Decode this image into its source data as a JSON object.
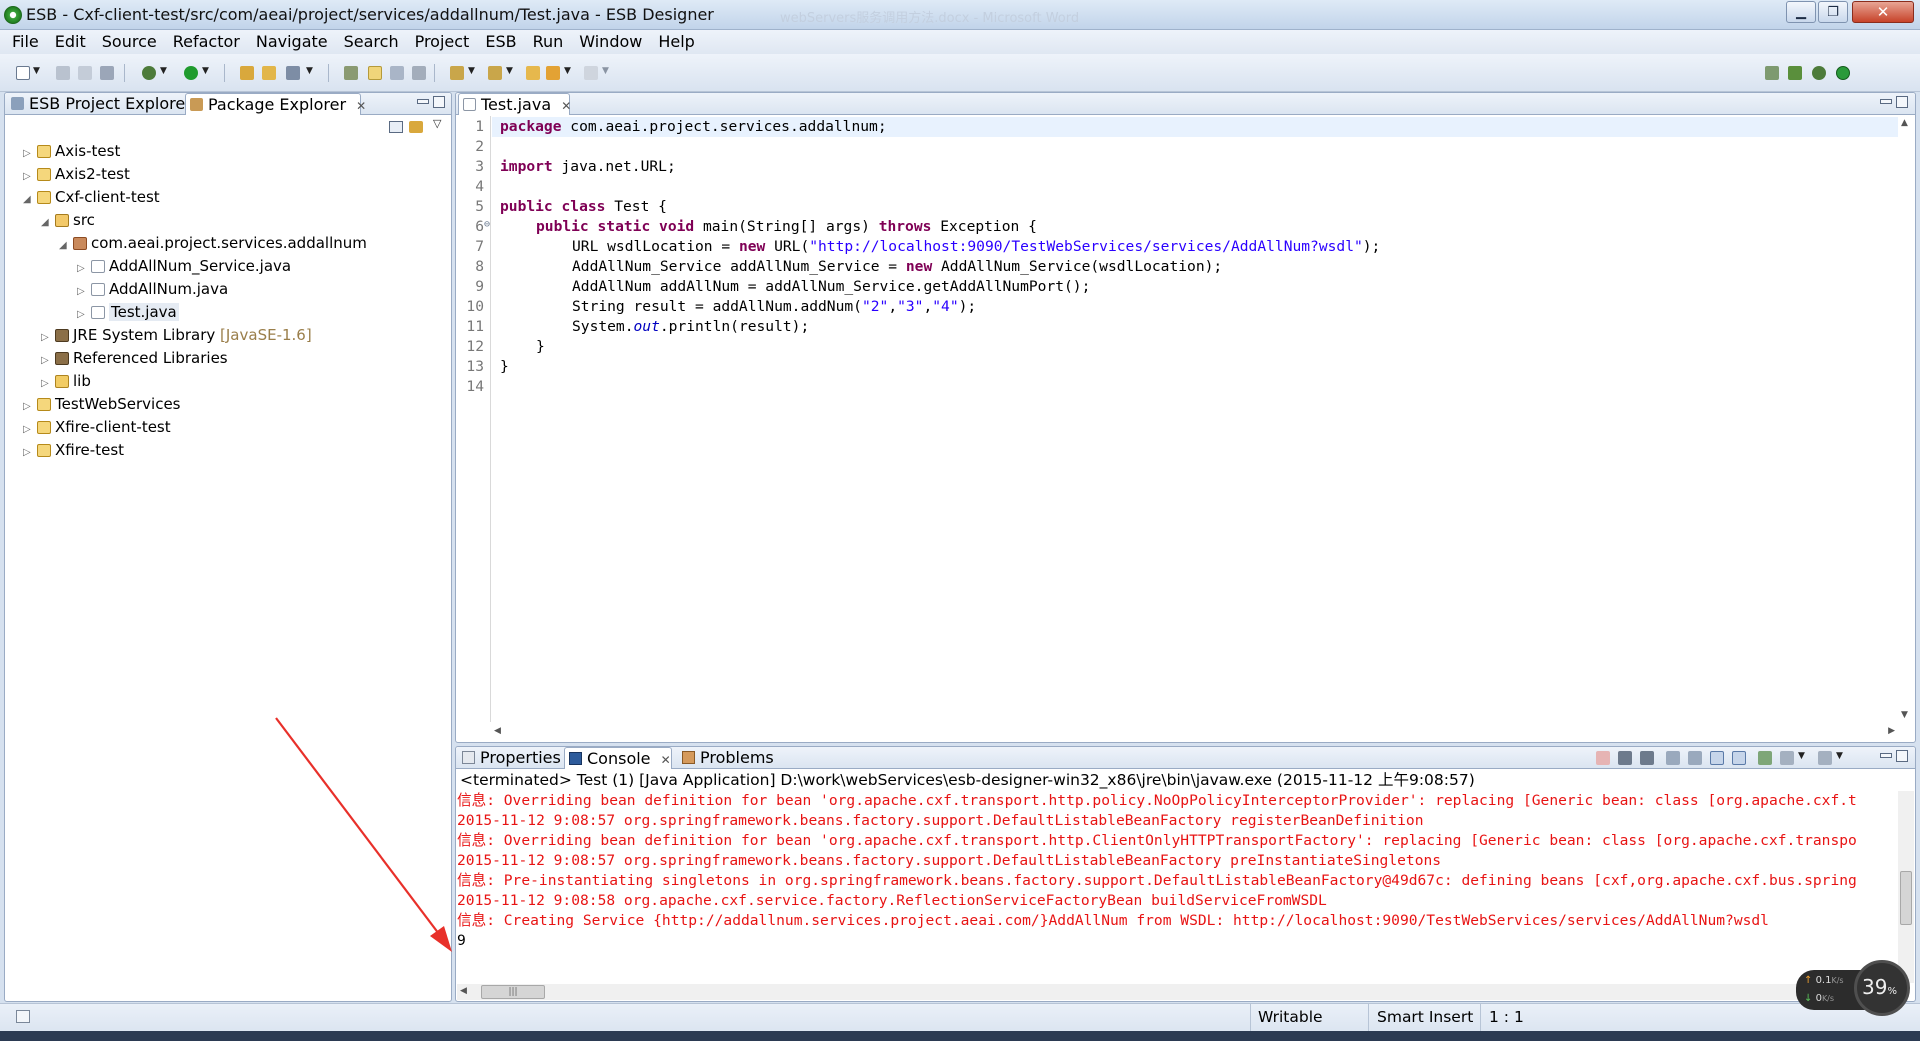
{
  "window": {
    "title": "ESB - Cxf-client-test/src/com/aeai/project/services/addallnum/Test.java - ESB Designer",
    "background_window_title": "webServers服务调用方法.docx - Microsoft Word"
  },
  "menu": [
    "File",
    "Edit",
    "Source",
    "Refactor",
    "Navigate",
    "Search",
    "Project",
    "ESB",
    "Run",
    "Window",
    "Help"
  ],
  "left_panel": {
    "tabs": [
      {
        "label": "ESB Project Explorer"
      },
      {
        "label": "Package Explorer"
      }
    ],
    "tree": [
      {
        "label": "Axis-test"
      },
      {
        "label": "Axis2-test"
      },
      {
        "label": "Cxf-client-test"
      },
      {
        "label": "src"
      },
      {
        "label": "com.aeai.project.services.addallnum"
      },
      {
        "label": "AddAllNum_Service.java"
      },
      {
        "label": "AddAllNum.java"
      },
      {
        "label": "Test.java"
      },
      {
        "label": "JRE System Library",
        "suffix": "[JavaSE-1.6]"
      },
      {
        "label": "Referenced Libraries"
      },
      {
        "label": "lib"
      },
      {
        "label": "TestWebServices"
      },
      {
        "label": "Xfire-client-test"
      },
      {
        "label": "Xfire-test"
      }
    ]
  },
  "editor": {
    "tab": "Test.java",
    "line_numbers": [
      "1",
      "2",
      "3",
      "4",
      "5",
      "6",
      "7",
      "8",
      "9",
      "10",
      "11",
      "12",
      "13",
      "14"
    ],
    "fold_marker": "⊖",
    "code": {
      "l1_kw": "package",
      "l1_rest": " com.aeai.project.services.addallnum;",
      "l3_kw": "import",
      "l3_rest": " java.net.URL;",
      "l5_kw1": "public",
      "l5_kw2": "class",
      "l5_rest": " Test {",
      "l6_kw1": "public",
      "l6_kw2": "static",
      "l6_kw3": "void",
      "l6_mid": " main(String[] args) ",
      "l6_kw4": "throws",
      "l6_rest": " Exception {",
      "l7_a": "URL wsdlLocation = ",
      "l7_kw": "new",
      "l7_b": " URL(",
      "l7_str": "\"http://localhost:9090/TestWebServices/services/AddAllNum?wsdl\"",
      "l7_c": ");",
      "l8_a": "AddAllNum_Service addAllNum_Service = ",
      "l8_kw": "new",
      "l8_b": " AddAllNum_Service(wsdlLocation);",
      "l9": "AddAllNum addAllNum = addAllNum_Service.getAddAllNumPort();",
      "l10_a": "String result = addAllNum.addNum(",
      "l10_s1": "\"2\"",
      "l10_comma1": ",",
      "l10_s2": "\"3\"",
      "l10_comma2": ",",
      "l10_s3": "\"4\"",
      "l10_b": ");",
      "l11_a": "System.",
      "l11_fld": "out",
      "l11_b": ".println(result);",
      "l12": "}",
      "l13": "}"
    }
  },
  "bottom_panel": {
    "tabs": [
      {
        "label": "Properties"
      },
      {
        "label": "Console"
      },
      {
        "label": "Problems"
      }
    ],
    "header": "<terminated> Test (1) [Java Application] D:\\work\\webServices\\esb-designer-win32_x86\\jre\\bin\\javaw.exe (2015-11-12 上午9:08:57)",
    "lines": [
      "信息: Overriding bean definition for bean 'org.apache.cxf.transport.http.policy.NoOpPolicyInterceptorProvider': replacing [Generic bean: class [org.apache.cxf.t",
      "2015-11-12 9:08:57 org.springframework.beans.factory.support.DefaultListableBeanFactory registerBeanDefinition",
      "信息: Overriding bean definition for bean 'org.apache.cxf.transport.http.ClientOnlyHTTPTransportFactory': replacing [Generic bean: class [org.apache.cxf.transpo",
      "2015-11-12 9:08:57 org.springframework.beans.factory.support.DefaultListableBeanFactory preInstantiateSingletons",
      "信息: Pre-instantiating singletons in org.springframework.beans.factory.support.DefaultListableBeanFactory@49d67c: defining beans [cxf,org.apache.cxf.bus.spring",
      "2015-11-12 9:08:58 org.apache.cxf.service.factory.ReflectionServiceFactoryBean buildServiceFromWSDL",
      "信息: Creating Service {http://addallnum.services.project.aeai.com/}AddAllNum from WSDL: http://localhost:9090/TestWebServices/services/AddAllNum?wsdl"
    ],
    "result": "9",
    "hscroll_thumb": "|||"
  },
  "status": {
    "writable": "Writable",
    "insert_mode": "Smart Insert",
    "position": "1 : 1"
  },
  "net_widget": {
    "up": "0.1",
    "up_unit": "K/s",
    "down": "0",
    "down_unit": "K/s",
    "percent": "39",
    "percent_sign": "%"
  },
  "colors": {
    "keyword": "#7f0055",
    "string": "#2a00ff",
    "console_error": "#e81414",
    "annotation_arrow": "#e8302a"
  }
}
